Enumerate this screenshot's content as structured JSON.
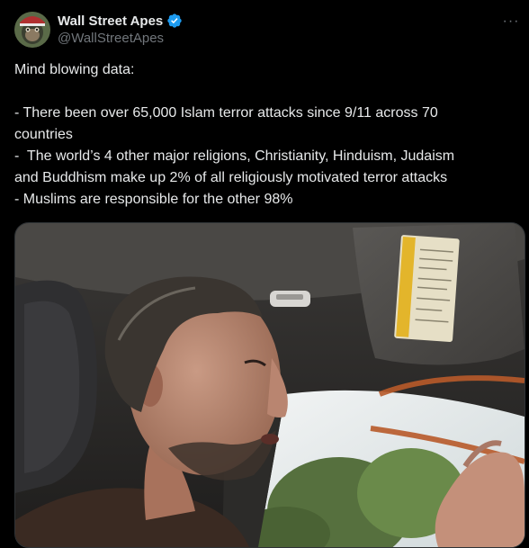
{
  "author": {
    "display_name": "Wall Street Apes",
    "handle": "@WallStreetApes",
    "verified": true,
    "avatar_icon": "ape-avatar-icon"
  },
  "post": {
    "lines": [
      "Mind blowing data:",
      "",
      "- There been over 65,000 Islam terror attacks since 9/11 across 70",
      "countries",
      "-  The world’s 4 other major religions, Christianity, Hinduism, Judaism",
      "and Buddhism make up 2% of all religiously motivated terror attacks",
      "- Muslims are responsible for the other 98%"
    ]
  },
  "media": {
    "type": "video-thumbnail"
  },
  "colors": {
    "background": "#000000",
    "text_primary": "#e7e9ea",
    "text_secondary": "#71767b",
    "verified_blue": "#1d9bf0"
  }
}
